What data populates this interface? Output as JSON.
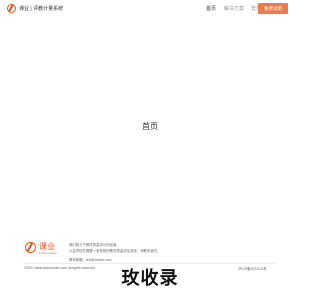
{
  "header": {
    "brand": "课业 | 评教计量系统",
    "nav": [
      {
        "label": "首页",
        "active": true
      },
      {
        "label": "解决方案",
        "active": false
      },
      {
        "label": "登录",
        "active": false
      }
    ],
    "cta_label": "免费试用",
    "accent_color": "#e8541c",
    "cta_color": "#f07a4f"
  },
  "main": {
    "title": "首页"
  },
  "footer": {
    "logo_text": "课业",
    "logo_sub": "Lessonsdev",
    "desc_lines": [
      "我们致力于教学质量评价的创新，",
      "以及学校在需要一条有效的教学质量评估系统，请联系我们。"
    ],
    "email": "联系邮箱：test@admin.com",
    "copyright": "©2021 www.lessonsdev.com all rights reserved",
    "icp": "沪ICP备2021123号",
    "watermark": "玫收录"
  }
}
